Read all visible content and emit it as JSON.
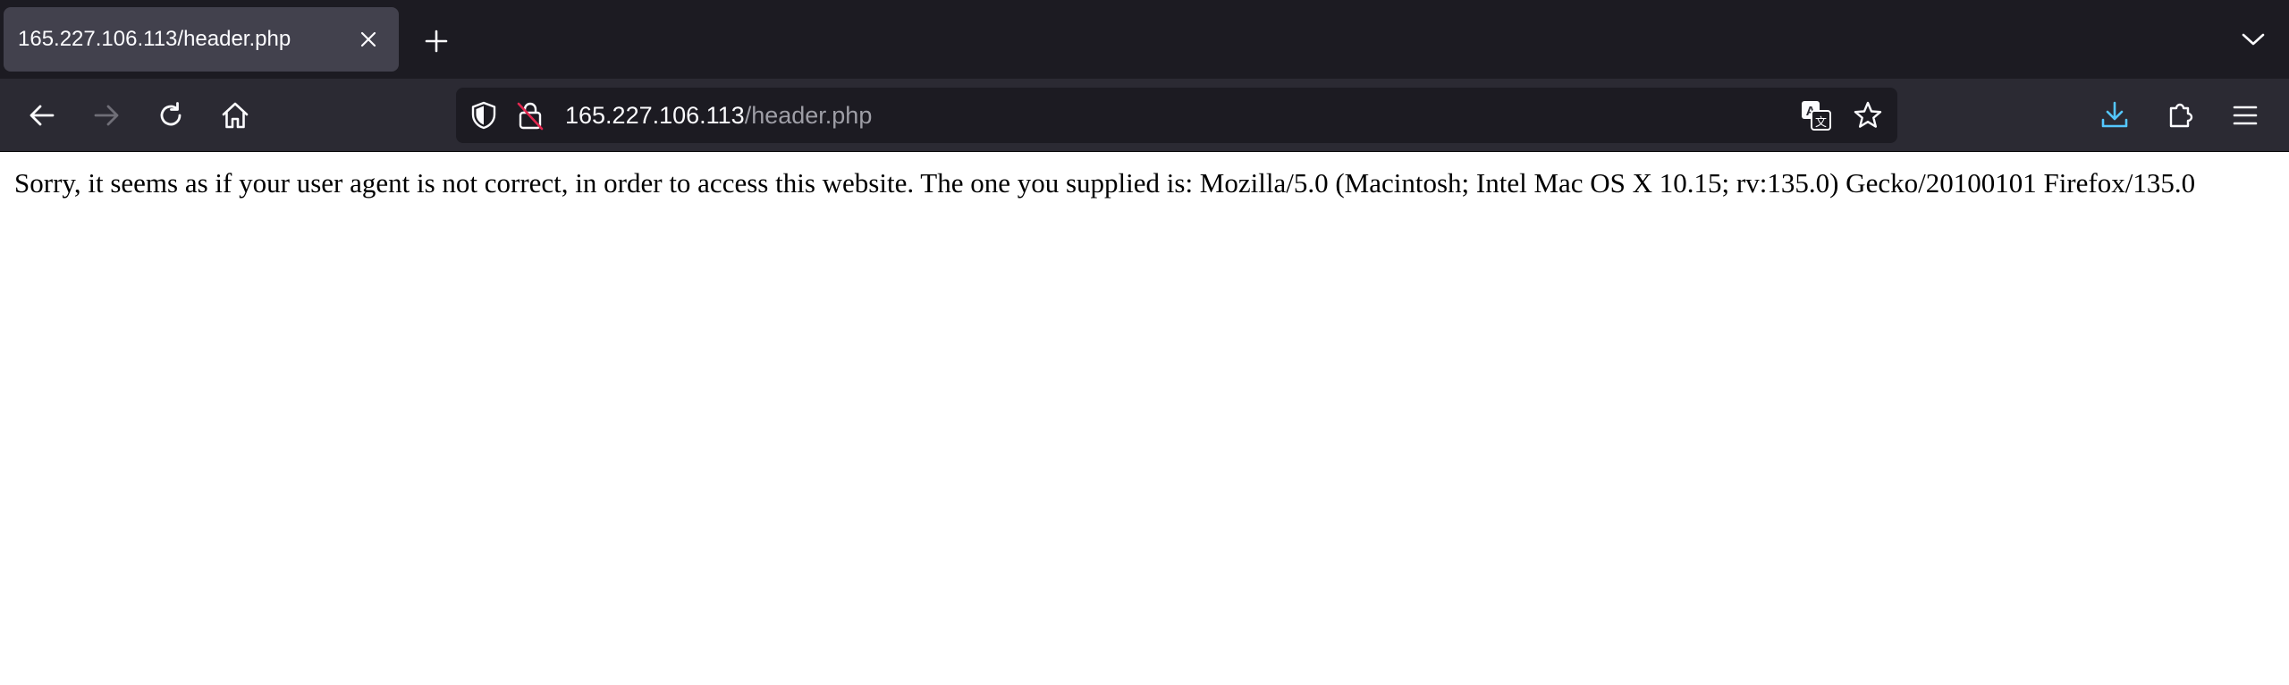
{
  "browser": {
    "tab": {
      "title": "165.227.106.113/header.php"
    },
    "toolbar": {
      "back_icon": "arrow-left-icon",
      "forward_icon": "arrow-right-icon",
      "reload_icon": "reload-icon",
      "home_icon": "home-icon",
      "downloads_icon": "download-icon",
      "extensions_icon": "puzzle-icon",
      "menu_icon": "hamburger-menu-icon"
    },
    "urlbar": {
      "host": "165.227.106.113",
      "path": "/header.php"
    },
    "colors": {
      "tabstrip": "#1c1b22",
      "active_tab": "#42414d",
      "navbar": "#2b2a33",
      "urlbar": "#1c1b22",
      "download_accent": "#54c7ff",
      "insecure_slash": "#e22850"
    }
  },
  "page": {
    "message": "Sorry, it seems as if your user agent is not correct, in order to access this website. The one you supplied is: Mozilla/5.0 (Macintosh; Intel Mac OS X 10.15; rv:135.0) Gecko/20100101 Firefox/135.0"
  }
}
